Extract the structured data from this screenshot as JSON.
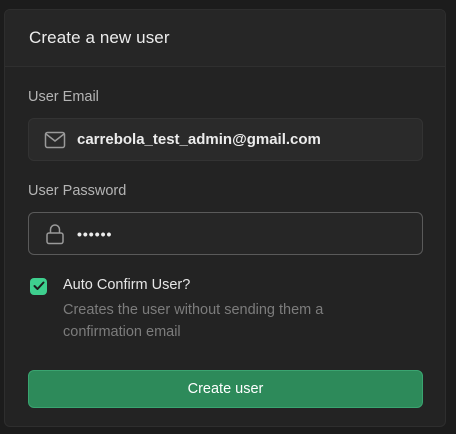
{
  "header": {
    "title": "Create a new user"
  },
  "form": {
    "email": {
      "label": "User Email",
      "value": "carrebola_test_admin@gmail.com",
      "icon": "mail-icon"
    },
    "password": {
      "label": "User Password",
      "value": "••••••",
      "icon": "lock-icon"
    },
    "auto_confirm": {
      "label": "Auto Confirm User?",
      "description": "Creates the user without sending them a confirmation email",
      "checked": true
    },
    "submit_label": "Create user"
  },
  "colors": {
    "accent": "#3ecf8e",
    "button": "#2d8a5a"
  }
}
